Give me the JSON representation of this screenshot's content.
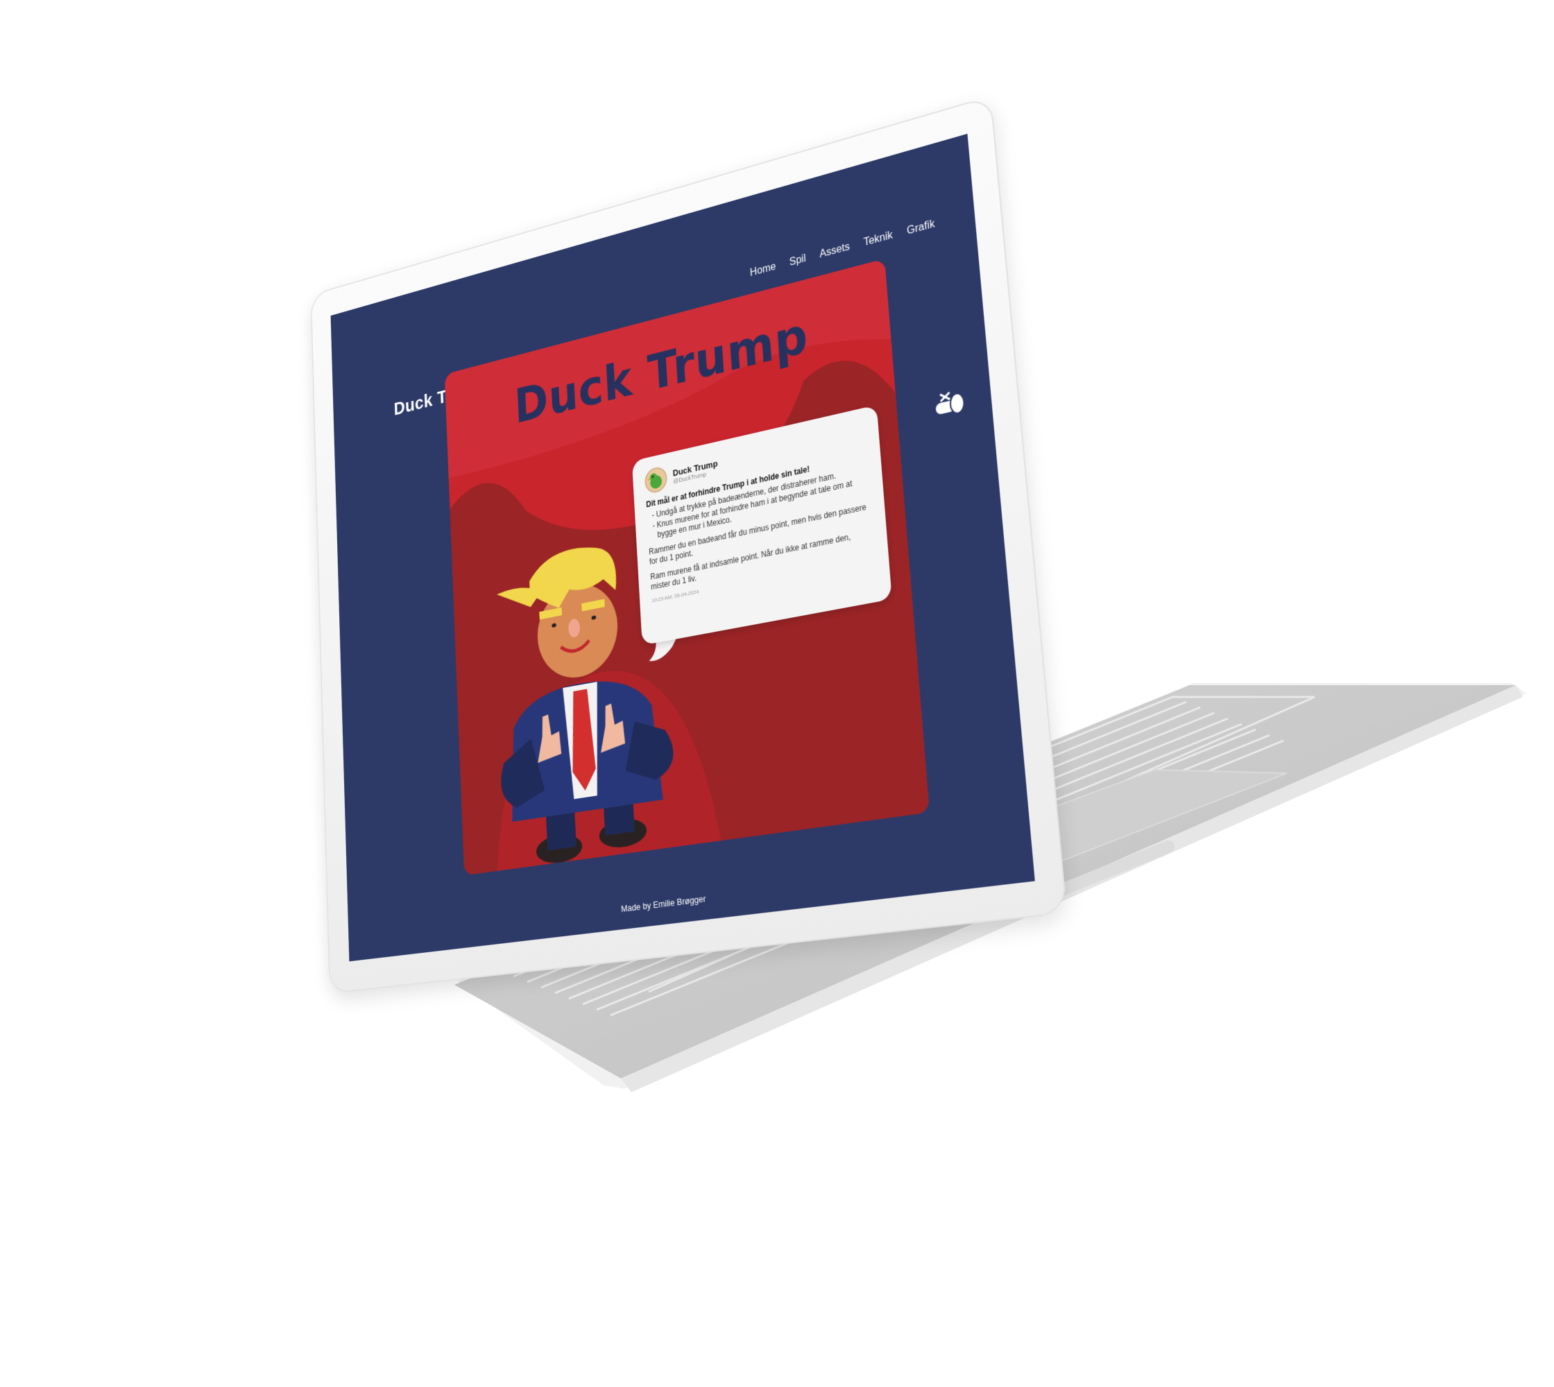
{
  "site": {
    "title": "Duck Trump",
    "nav": [
      "Home",
      "Spil",
      "Assets",
      "Teknik",
      "Grafik"
    ],
    "footer": "Made by Emilie Brøgger"
  },
  "game": {
    "title": "Duck Trump",
    "tweet": {
      "name": "Duck Trump",
      "handle": "@DuckTrump",
      "lead": "Dit mål er at forhindre Trump i at holde sin tale!",
      "bullets": [
        "Undgå at trykke på badeænderne, der distraherer ham.",
        "Knus murene for at forhindre ham i at begynde at tale om at bygge en mur i Mexico."
      ],
      "paragraphs": [
        "Rammer du en badeand får du minus point, men hvis den passere for du 1 point.",
        "Ram murene få at indsamle point. Når du ikke at ramme den, mister du 1 liv."
      ],
      "time": "10:23 AM, 05-04-2024"
    }
  },
  "icons": {
    "mute": "sound-off-icon",
    "avatar": "duck-avatar-icon"
  },
  "colors": {
    "page_bg": "#2d3a68",
    "game_red": "#c8252d",
    "title_navy": "#26315f",
    "tweet_bg": "#f4f4f4"
  }
}
